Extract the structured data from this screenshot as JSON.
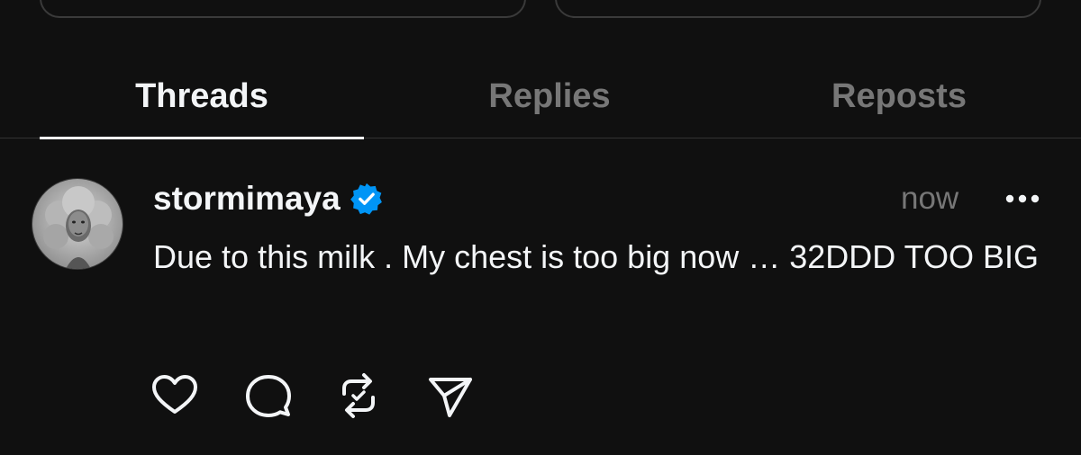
{
  "tabs": [
    {
      "label": "Threads",
      "active": true
    },
    {
      "label": "Replies",
      "active": false
    },
    {
      "label": "Reposts",
      "active": false
    }
  ],
  "post": {
    "username": "stormimaya",
    "verified": true,
    "timestamp": "now",
    "text": "Due to this milk . My chest is too big now … 32DDD TOO BIG",
    "actions": [
      "heart-icon",
      "comment-icon",
      "repost-icon",
      "share-icon"
    ]
  },
  "colors": {
    "background": "#101010",
    "text_primary": "#f3f5f7",
    "text_secondary": "#777777",
    "verified_badge": "#0095f6",
    "divider": "#333333"
  }
}
